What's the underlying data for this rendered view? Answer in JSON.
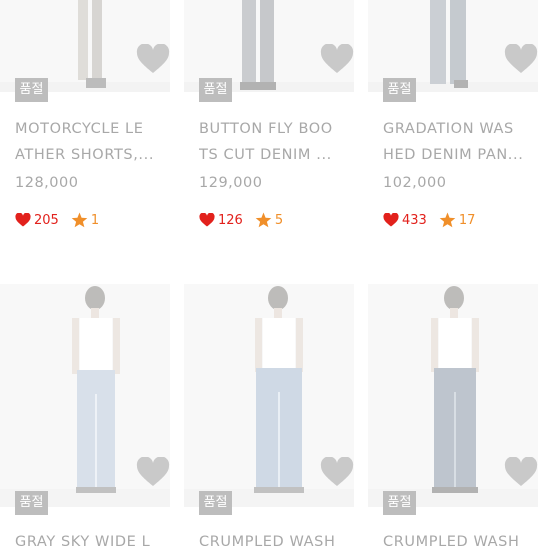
{
  "products_row1": [
    {
      "badge": "품절",
      "title_line1": "MOTORCYCLE LE",
      "title_line2": "ATHER SHORTS,...",
      "price": "128,000",
      "likes": "205",
      "rating_count": "1"
    },
    {
      "badge": "품절",
      "title_line1": "BUTTON FLY BOO",
      "title_line2": "TS CUT DENIM ...",
      "price": "129,000",
      "likes": "126",
      "rating_count": "5"
    },
    {
      "badge": "품절",
      "title_line1": "GRADATION WAS",
      "title_line2": "HED DENIM PAN...",
      "price": "102,000",
      "likes": "433",
      "rating_count": "17"
    }
  ],
  "products_row2": [
    {
      "badge": "품절",
      "title_line1": "GRAY SKY WIDE L"
    },
    {
      "badge": "품절",
      "title_line1": "CRUMPLED WASH"
    },
    {
      "badge": "품절",
      "title_line1": "CRUMPLED WASH"
    }
  ],
  "icons": {
    "wishlist": "heart-outline-icon",
    "likes": "heart-icon",
    "rating": "star-icon"
  },
  "colors": {
    "badge_bg": "#bdbdbd",
    "muted_text": "#a8a8a8",
    "likes": "#e2211c",
    "star": "#f08f2a"
  }
}
